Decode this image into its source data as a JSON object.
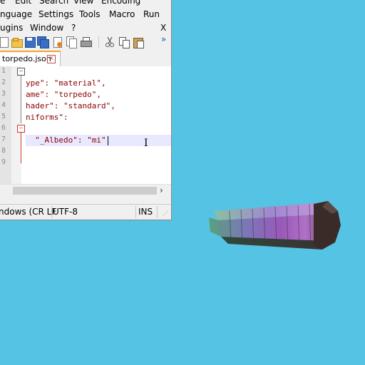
{
  "menu_row1": {
    "file": "e",
    "edit": "Edit",
    "search": "Search",
    "view": "View",
    "encoding": "Encoding"
  },
  "menu_row2": {
    "language": "nguage",
    "settings": "Settings",
    "tools": "Tools",
    "macro": "Macro",
    "run": "Run"
  },
  "menu_row3": {
    "plugins": "ugins",
    "window": "Window",
    "help": "?",
    "close": "X"
  },
  "toolbar": {
    "overflow": "»"
  },
  "tab": {
    "label": "torpedo.json",
    "close": "x"
  },
  "editor": {
    "line_numbers": [
      "1",
      "2",
      "3",
      "4",
      "5",
      "6",
      "7",
      "8",
      "9"
    ],
    "lines": [
      "ype\": \"material\",",
      "ame\": \"torpedo\",",
      "hader\": \"standard\",",
      "niforms\":",
      "  \"_Albedo\": \"mi\""
    ]
  },
  "scroll": {
    "right_arrow": "›"
  },
  "statusbar": {
    "eol": "ndows (CR LF",
    "encoding": "UTF-8",
    "mode": "INS"
  }
}
